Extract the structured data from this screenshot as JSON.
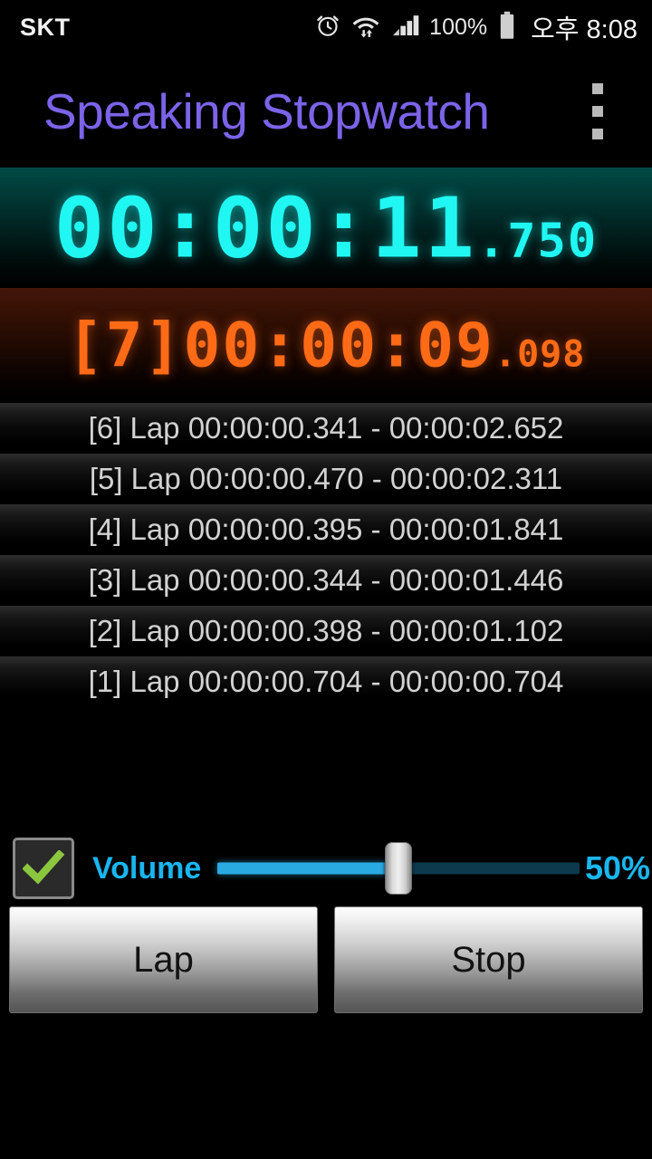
{
  "status_bar": {
    "carrier": "SKT",
    "battery_percent": "100%",
    "clock": "오후 8:08",
    "icons": [
      "alarm-clock-icon",
      "wifi-icon",
      "cellular-signal-icon",
      "battery-icon"
    ]
  },
  "title_bar": {
    "app_title": "Speaking Stopwatch",
    "overflow_menu": "overflow-menu-icon",
    "title_color": "#7C63E8"
  },
  "main_display": {
    "time_main": "00:00:11",
    "time_decimal": ".750",
    "full_value": "00:00:11.750",
    "color": "#20F7F2",
    "background_color": "#014a46"
  },
  "lap_display": {
    "index": "[7]",
    "time_main": "00:00:09",
    "time_decimal": ".098",
    "full_value": "[7] 00:00:09.098",
    "color": "#FF6A16",
    "background_color": "#45160a"
  },
  "lap_list": [
    {
      "text": "[6] Lap 00:00:00.341 - 00:00:02.652",
      "index": "[6]",
      "lap_time": "00:00:00.341",
      "split_time": "00:00:02.652"
    },
    {
      "text": "[5] Lap 00:00:00.470 - 00:00:02.311",
      "index": "[5]",
      "lap_time": "00:00:00.470",
      "split_time": "00:00:02.311"
    },
    {
      "text": "[4] Lap 00:00:00.395 - 00:00:01.841",
      "index": "[4]",
      "lap_time": "00:00:00.395",
      "split_time": "00:00:01.841"
    },
    {
      "text": "[3] Lap 00:00:00.344 - 00:00:01.446",
      "index": "[3]",
      "lap_time": "00:00:00.344",
      "split_time": "00:00:01.446"
    },
    {
      "text": "[2] Lap 00:00:00.398 - 00:00:01.102",
      "index": "[2]",
      "lap_time": "00:00:00.398",
      "split_time": "00:00:01.102"
    },
    {
      "text": "[1] Lap 00:00:00.704 - 00:00:00.704",
      "index": "[1]",
      "lap_time": "00:00:00.704",
      "split_time": "00:00:00.704"
    }
  ],
  "volume": {
    "checkbox_checked": true,
    "checkbox_icon": "checkmark-icon",
    "label": "Volume",
    "percent_text": "50%",
    "percent_value": 50,
    "accent_color": "#19B6F0",
    "check_color": "#8CC63F"
  },
  "buttons": {
    "lap_label": "Lap",
    "stop_label": "Stop"
  }
}
